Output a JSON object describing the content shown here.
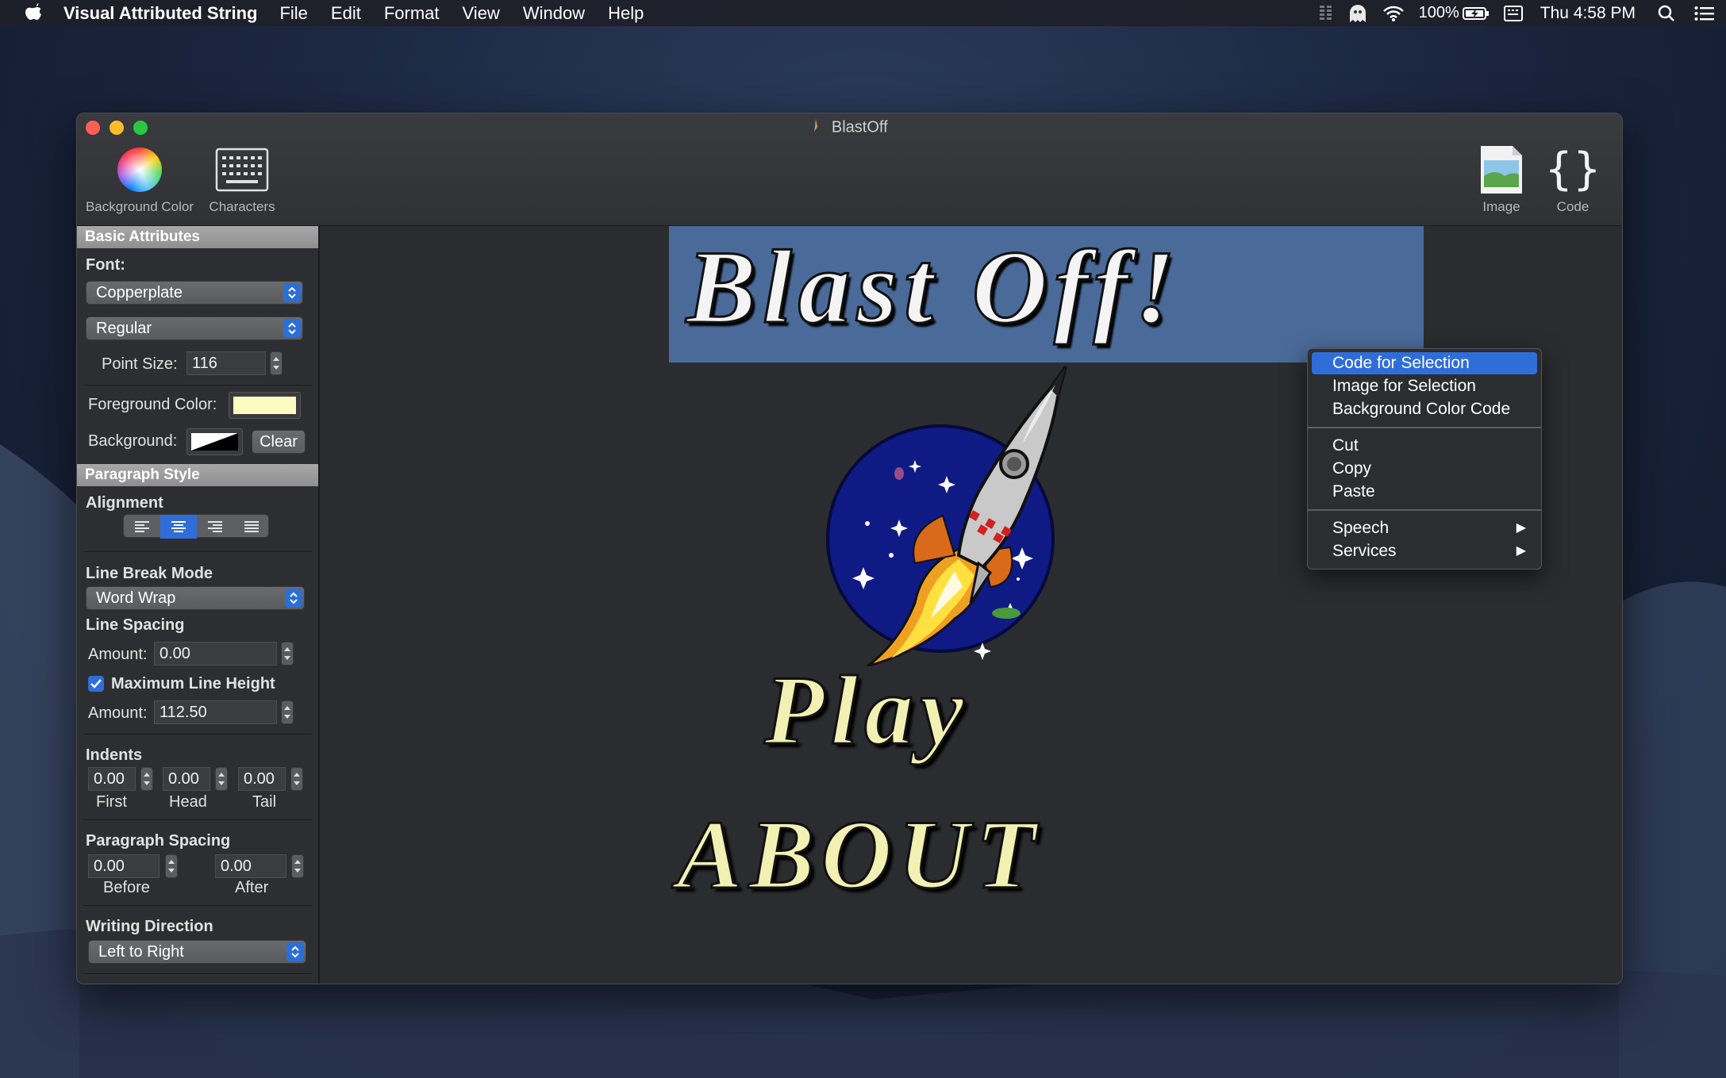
{
  "menubar": {
    "app_name": "Visual Attributed String",
    "menus": [
      "File",
      "Edit",
      "Format",
      "View",
      "Window",
      "Help"
    ],
    "battery": "100%",
    "clock": "Thu 4:58 PM"
  },
  "window": {
    "title": "BlastOff",
    "toolbar": {
      "background_color_label": "Background Color",
      "characters_label": "Characters",
      "image_label": "Image",
      "code_label": "Code"
    }
  },
  "sidebar": {
    "basic_attributes": {
      "header": "Basic Attributes",
      "font_label": "Font:",
      "font_family": "Copperplate",
      "font_style": "Regular",
      "point_size_label": "Point Size:",
      "point_size": "116",
      "foreground_label": "Foreground Color:",
      "foreground_color": "#fdfbbf",
      "background_label": "Background:",
      "clear_label": "Clear"
    },
    "paragraph_style": {
      "header": "Paragraph Style",
      "alignment_label": "Alignment",
      "alignment_selected": "center",
      "line_break_label": "Line Break Mode",
      "line_break_value": "Word Wrap",
      "line_spacing_label": "Line Spacing",
      "amount_label": "Amount:",
      "line_spacing_amount": "0.00",
      "max_line_height_label": "Maximum Line Height",
      "max_line_height_checked": true,
      "max_line_height_amount": "112.50",
      "indents_label": "Indents",
      "indent_first": "0.00",
      "indent_head": "0.00",
      "indent_tail": "0.00",
      "first_label": "First",
      "head_label": "Head",
      "tail_label": "Tail",
      "paragraph_spacing_label": "Paragraph Spacing",
      "spacing_before": "0.00",
      "spacing_after": "0.00",
      "before_label": "Before",
      "after_label": "After",
      "writing_direction_label": "Writing Direction",
      "writing_direction_value": "Left to Right"
    }
  },
  "canvas": {
    "title_text": "Blast Off!",
    "play_text": "Play",
    "about_text": "ABOUT",
    "selection_color": "#4a6b9a",
    "text_color": "#f3f0b4"
  },
  "context_menu": {
    "items": [
      {
        "label": "Code for Selection",
        "highlighted": true
      },
      {
        "label": "Image for Selection"
      },
      {
        "label": "Background Color Code"
      },
      {
        "label": "Cut"
      },
      {
        "label": "Copy"
      },
      {
        "label": "Paste"
      },
      {
        "label": "Speech",
        "submenu": true
      },
      {
        "label": "Services",
        "submenu": true
      }
    ]
  }
}
